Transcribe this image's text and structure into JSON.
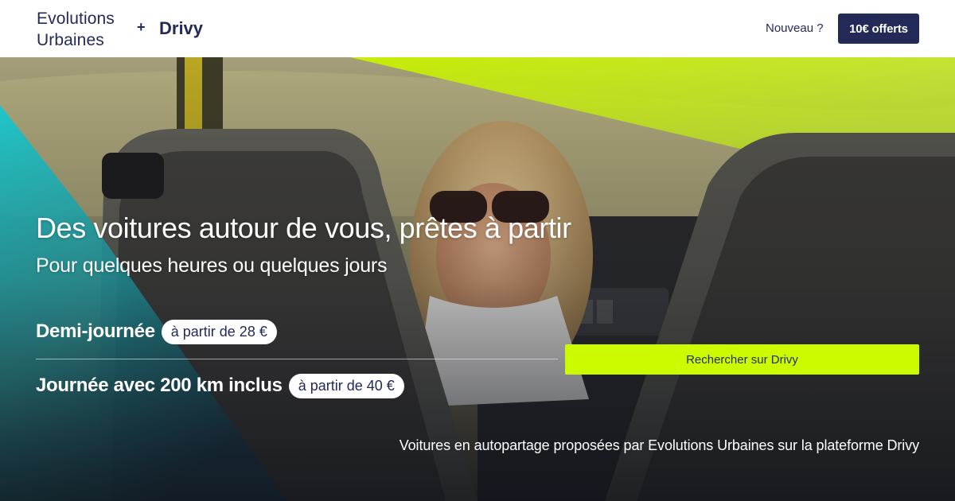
{
  "header": {
    "logo_line1": "Evolutions",
    "logo_line2": "Urbaines",
    "plus_sign": "+",
    "partner": "Drivy",
    "nav_link": "Nouveau ?",
    "offer_button": "10€ offerts"
  },
  "hero": {
    "headline": "Des voitures autour de vous, prêtes à partir",
    "subheadline": "Pour quelques heures ou quelques jours",
    "offers": [
      {
        "name": "Demi-journée",
        "price": "à partir de 28 €"
      },
      {
        "name": "Journée avec 200 km inclus",
        "price": "à partir de 40 €"
      }
    ],
    "search_button": "Rechercher sur Drivy",
    "footnote": "Voitures en autopartage proposées par Evolutions Urbaines sur la plateforme Drivy"
  },
  "colors": {
    "brand_navy": "#232a57",
    "accent_lime": "#ccfb00",
    "overlay_teal": "#1ec8d2",
    "white": "#ffffff"
  }
}
